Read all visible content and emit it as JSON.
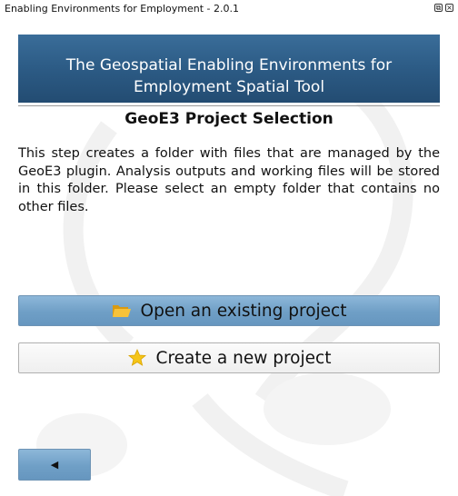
{
  "window": {
    "title": "Enabling Environments for Employment - 2.0.1",
    "float_glyph": "⧉",
    "close_glyph": "×"
  },
  "banner": {
    "line1": "The Geospatial Enabling Environments for",
    "line2": "Employment Spatial Tool"
  },
  "page": {
    "title": "GeoE3 Project Selection",
    "description": "This step creates a folder with files that are managed by the GeoE3 plugin. Analysis outputs and working files will be stored in this folder. Please select an empty folder that contains no other files."
  },
  "buttons": {
    "open_label": "Open an existing project",
    "open_icon": "folder-icon",
    "create_label": "Create a new project",
    "create_icon": "star-icon",
    "back_glyph": "◀",
    "back_icon": "back-arrow-icon"
  },
  "colors": {
    "banner": "#2c5b85",
    "primary_button": "#6f9fc6",
    "folder": "#f2b21c",
    "star": "#f5c518"
  }
}
